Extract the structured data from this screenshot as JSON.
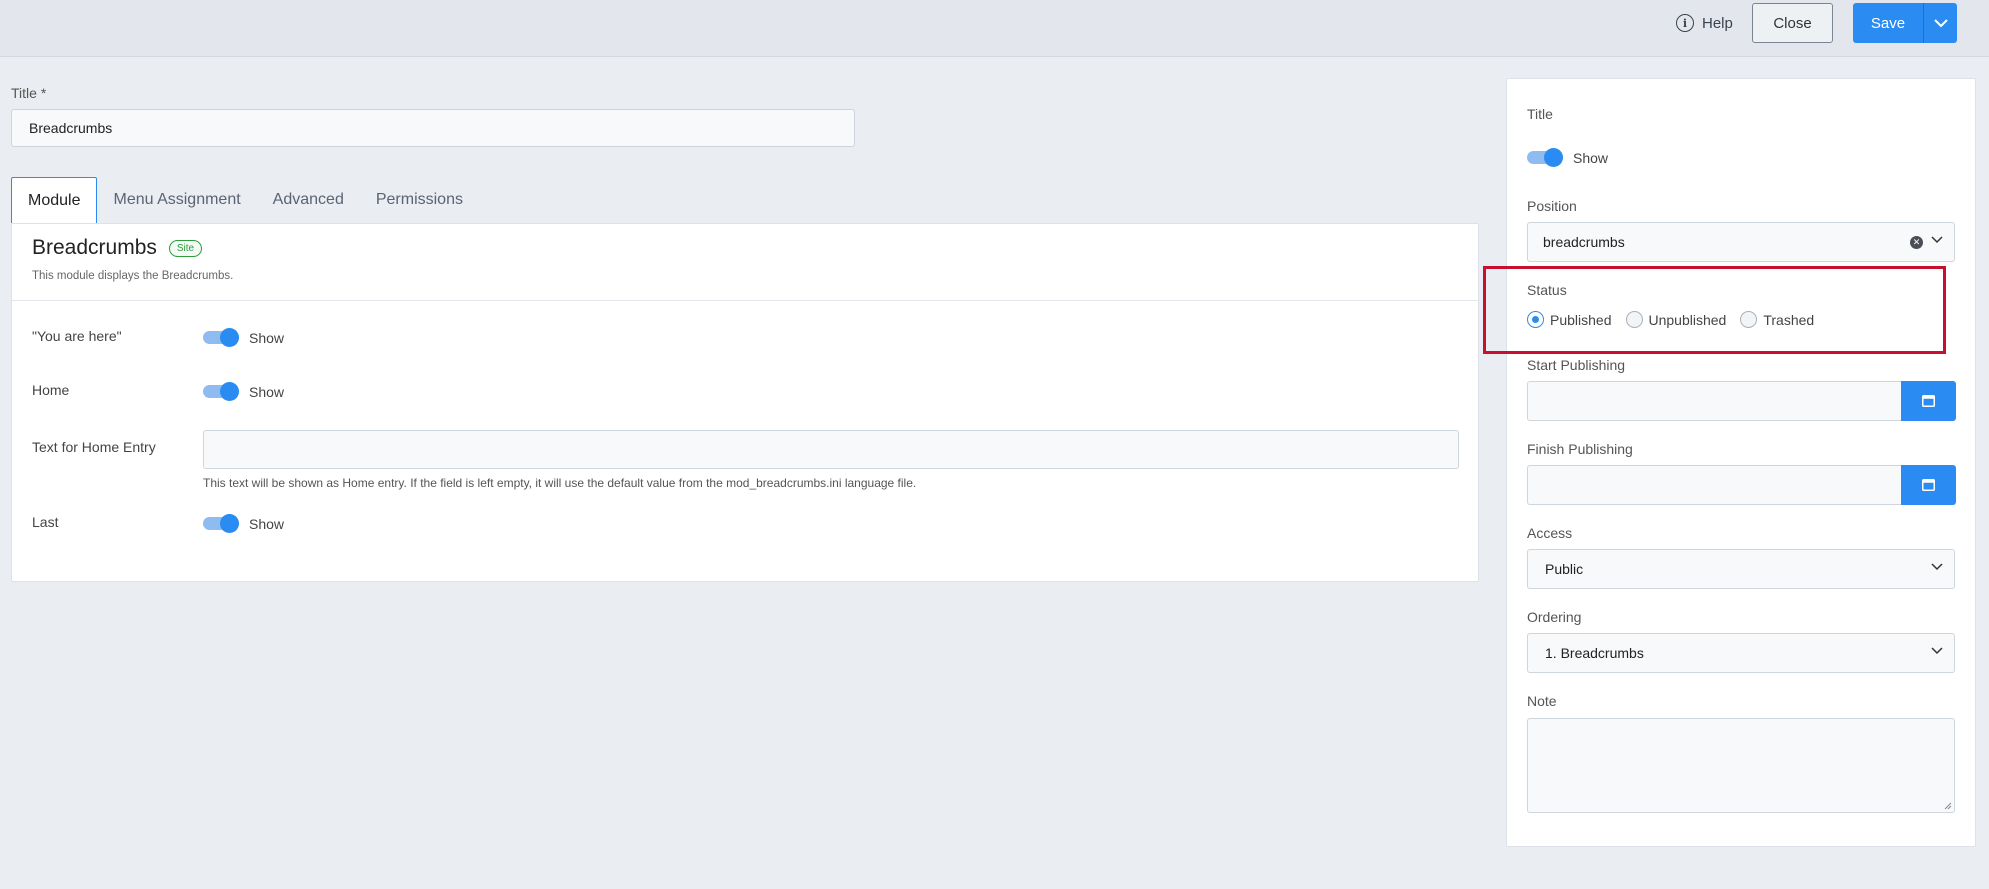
{
  "toolbar": {
    "help_label": "Help",
    "close_label": "Close",
    "save_label": "Save"
  },
  "title_field": {
    "label": "Title *",
    "value": "Breadcrumbs"
  },
  "tabs": [
    {
      "label": "Module"
    },
    {
      "label": "Menu Assignment"
    },
    {
      "label": "Advanced"
    },
    {
      "label": "Permissions"
    }
  ],
  "module": {
    "title": "Breadcrumbs",
    "badge": "Site",
    "description": "This module displays the Breadcrumbs.",
    "rows": {
      "you_are_here": {
        "label": "\"You are here\"",
        "state": "Show"
      },
      "home": {
        "label": "Home",
        "state": "Show"
      },
      "home_text": {
        "label": "Text for Home Entry",
        "value": "",
        "help": "This text will be shown as Home entry. If the field is left empty, it will use the default value from the mod_breadcrumbs.ini language file."
      },
      "last": {
        "label": "Last",
        "state": "Show"
      }
    }
  },
  "sidebar": {
    "title": {
      "label": "Title",
      "state": "Show"
    },
    "position": {
      "label": "Position",
      "value": "breadcrumbs"
    },
    "status": {
      "label": "Status",
      "options": [
        "Published",
        "Unpublished",
        "Trashed"
      ],
      "selected": "Published"
    },
    "start_publishing": {
      "label": "Start Publishing",
      "value": ""
    },
    "finish_publishing": {
      "label": "Finish Publishing",
      "value": ""
    },
    "access": {
      "label": "Access",
      "value": "Public"
    },
    "ordering": {
      "label": "Ordering",
      "value": "1. Breadcrumbs"
    },
    "note": {
      "label": "Note",
      "value": ""
    }
  },
  "colors": {
    "accent": "#2a8cf2",
    "highlight": "#c8102e",
    "badge_green": "#2d9c3c"
  }
}
